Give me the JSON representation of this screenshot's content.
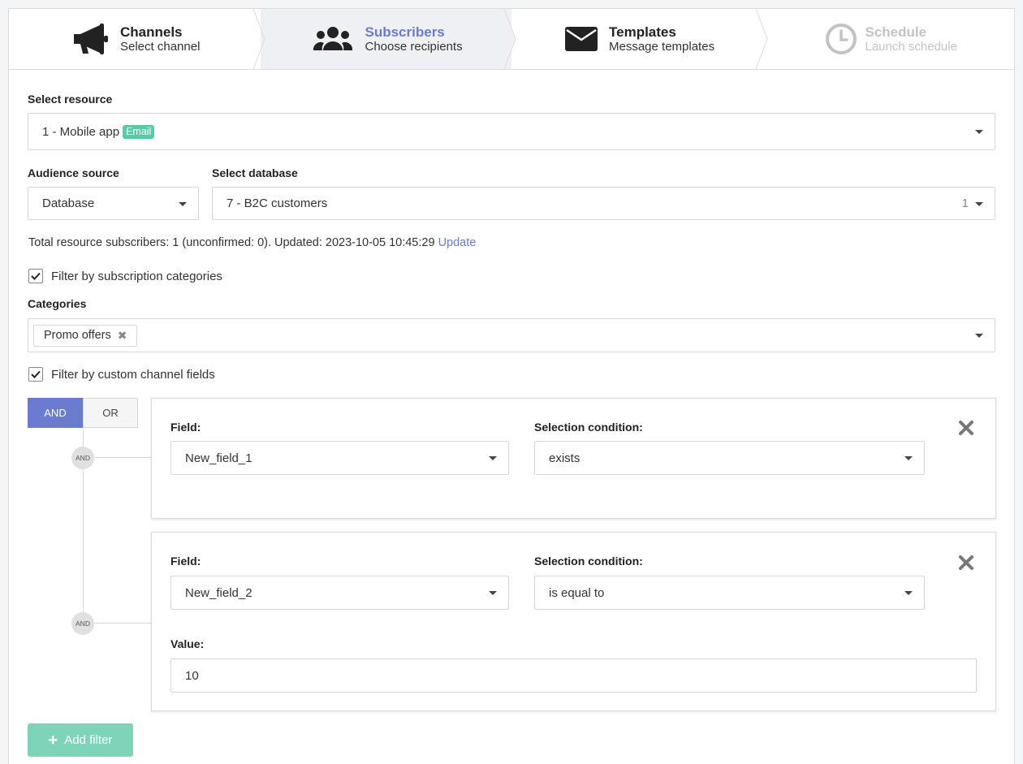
{
  "steps": [
    {
      "title": "Channels",
      "subtitle": "Select channel",
      "icon": "megaphone-icon",
      "state": "done"
    },
    {
      "title": "Subscribers",
      "subtitle": "Choose recipients",
      "icon": "users-icon",
      "state": "active"
    },
    {
      "title": "Templates",
      "subtitle": "Message templates",
      "icon": "envelope-icon",
      "state": "done"
    },
    {
      "title": "Schedule",
      "subtitle": "Launch schedule",
      "icon": "clock-icon",
      "state": "disabled"
    }
  ],
  "resource": {
    "label": "Select resource",
    "value": "1 - Mobile app",
    "badge": "Email"
  },
  "audience": {
    "label": "Audience source",
    "value": "Database"
  },
  "database": {
    "label": "Select database",
    "value": "7 - B2C customers",
    "count": "1"
  },
  "info": {
    "text": "Total resource subscribers: 1 (unconfirmed: 0). Updated: 2023-10-05 10:45:29",
    "link": "Update"
  },
  "filter_categories": {
    "checked": true,
    "label": "Filter by subscription categories"
  },
  "categories": {
    "label": "Categories",
    "tags": [
      "Promo offers"
    ]
  },
  "filter_custom": {
    "checked": true,
    "label": "Filter by custom channel fields"
  },
  "logic": {
    "and": "AND",
    "or": "OR",
    "selected": "AND",
    "connector": "AND"
  },
  "filters": [
    {
      "field_label": "Field:",
      "field": "New_field_1",
      "condition_label": "Selection condition:",
      "condition": "exists"
    },
    {
      "field_label": "Field:",
      "field": "New_field_2",
      "condition_label": "Selection condition:",
      "condition": "is equal to",
      "value_label": "Value:",
      "value": "10"
    }
  ],
  "add_filter": "Add filter",
  "colors": {
    "accent": "#6a7bd0",
    "green": "#5bc8a6",
    "green_button": "#7dd4b8"
  }
}
